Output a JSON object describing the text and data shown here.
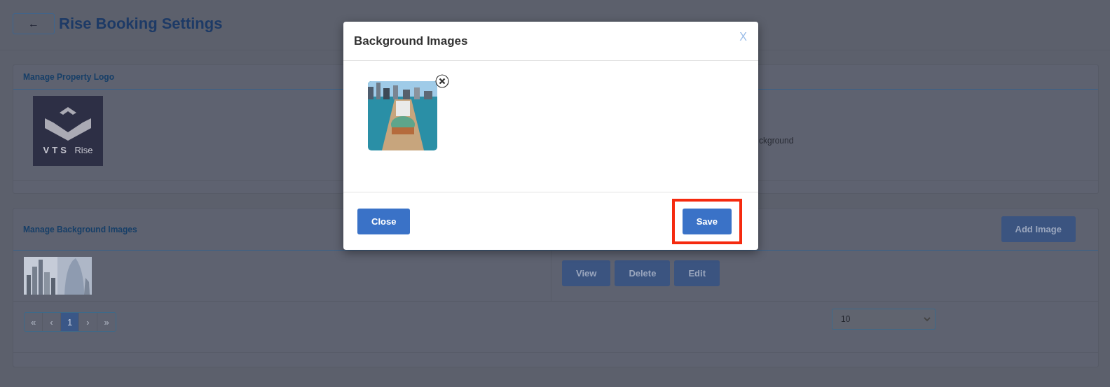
{
  "page": {
    "back_button": "←",
    "title": "Rise Booking Settings"
  },
  "logo_card": {
    "title": "Manage Property Logo",
    "logo": {
      "wordmark": "VTS",
      "suffix": "Rise"
    },
    "note": "ckground"
  },
  "background_card": {
    "title": "Manage Background Images",
    "add_button": "Add Image",
    "rows": [
      {
        "image": {
          "kind": "picture"
        },
        "actions": [
          "View",
          "Delete",
          "Edit"
        ]
      }
    ],
    "pagination": [
      {
        "label": "«",
        "selected": false
      },
      {
        "label": "‹",
        "selected": false
      },
      {
        "label": "1",
        "selected": true
      },
      {
        "label": "›",
        "selected": false
      },
      {
        "label": "»",
        "selected": false
      }
    ],
    "page_size": "10"
  },
  "modal": {
    "title": "Background Images",
    "close_x": "X",
    "images": [
      {
        "kind": "picture",
        "removable": true
      }
    ],
    "close_button": "Close",
    "save_button": "Save",
    "save_highlighted": true
  }
}
